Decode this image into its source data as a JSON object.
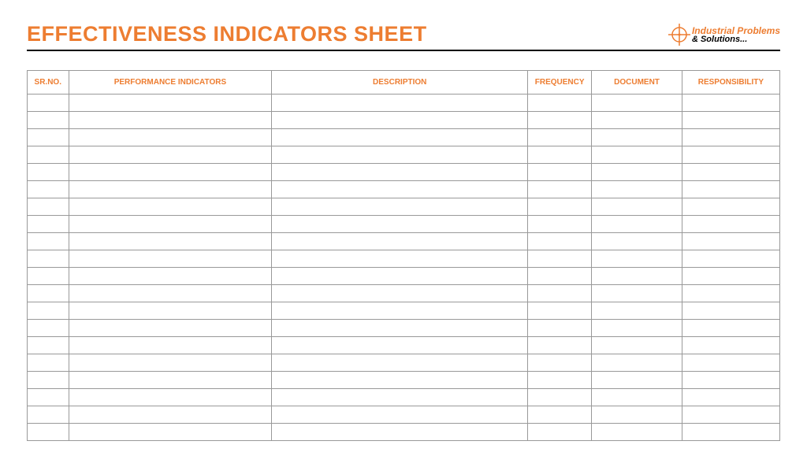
{
  "title": "EFFECTIVENESS INDICATORS SHEET",
  "logo": {
    "line1": "Industrial Problems",
    "line2": "& Solutions..."
  },
  "columns": {
    "sr": "SR.NO.",
    "perf": "PERFORMANCE INDICATORS",
    "desc": "DESCRIPTION",
    "freq": "FREQUENCY",
    "doc": "DOCUMENT",
    "resp": "RESPONSIBILITY"
  },
  "row_count": 20
}
